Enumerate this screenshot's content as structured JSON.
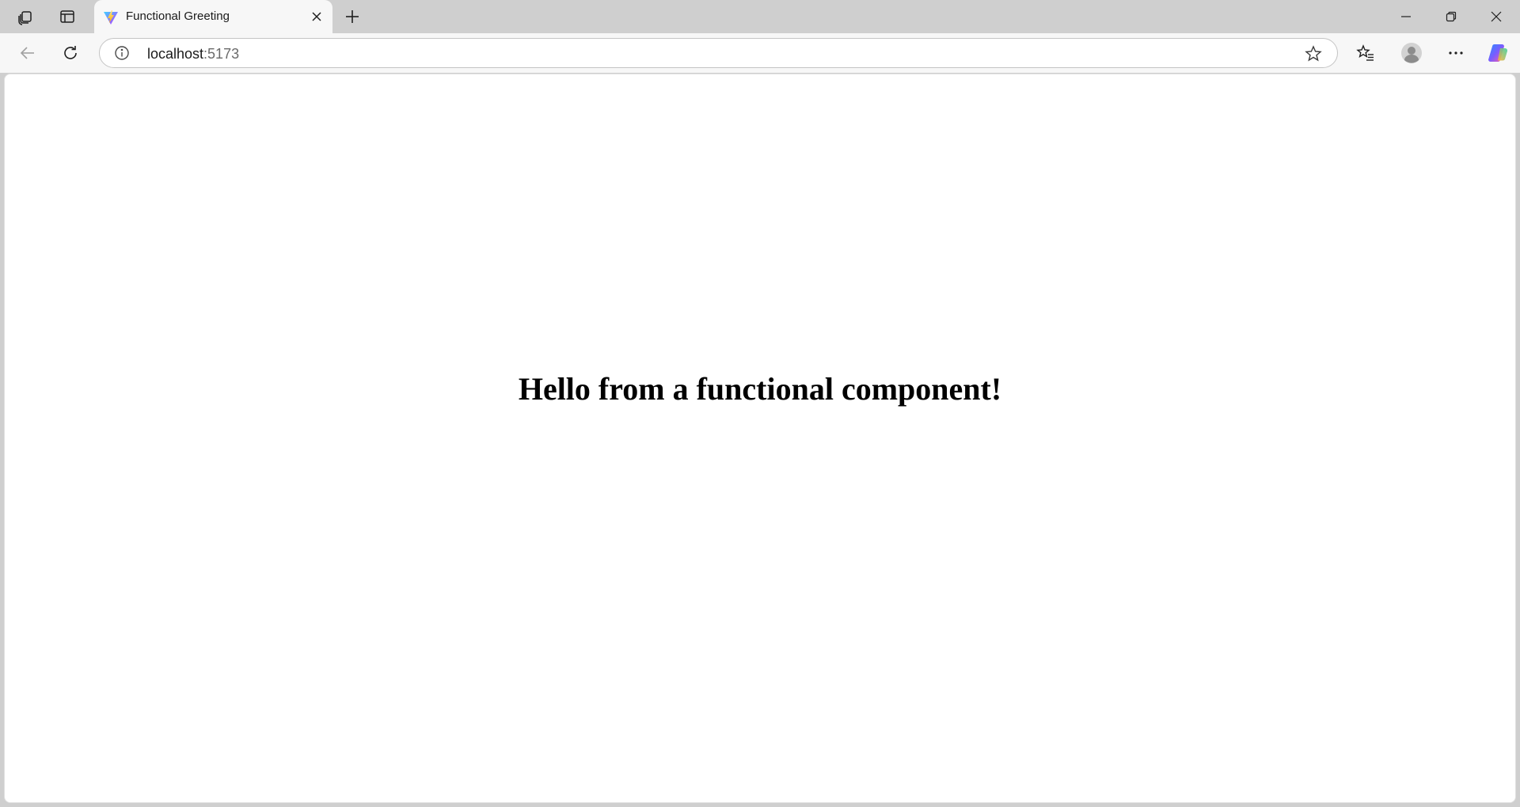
{
  "browser": {
    "tab": {
      "title": "Functional Greeting",
      "favicon": "vite-logo-icon"
    },
    "address_bar": {
      "host": "localhost",
      "port": ":5173"
    },
    "icons": {
      "workspaces": "workspaces-icon",
      "vertical_tabs": "tab-actions-icon",
      "close_tab": "close-icon",
      "new_tab": "plus-icon",
      "minimize": "minimize-icon",
      "restore": "restore-icon",
      "close_window": "close-icon",
      "back": "back-arrow-icon",
      "refresh": "refresh-icon",
      "site_info": "info-icon",
      "favorite": "star-icon",
      "favorites": "favorites-icon",
      "profile": "avatar-icon",
      "more": "more-icon",
      "copilot": "copilot-icon"
    }
  },
  "page": {
    "heading": "Hello from a functional component!"
  }
}
